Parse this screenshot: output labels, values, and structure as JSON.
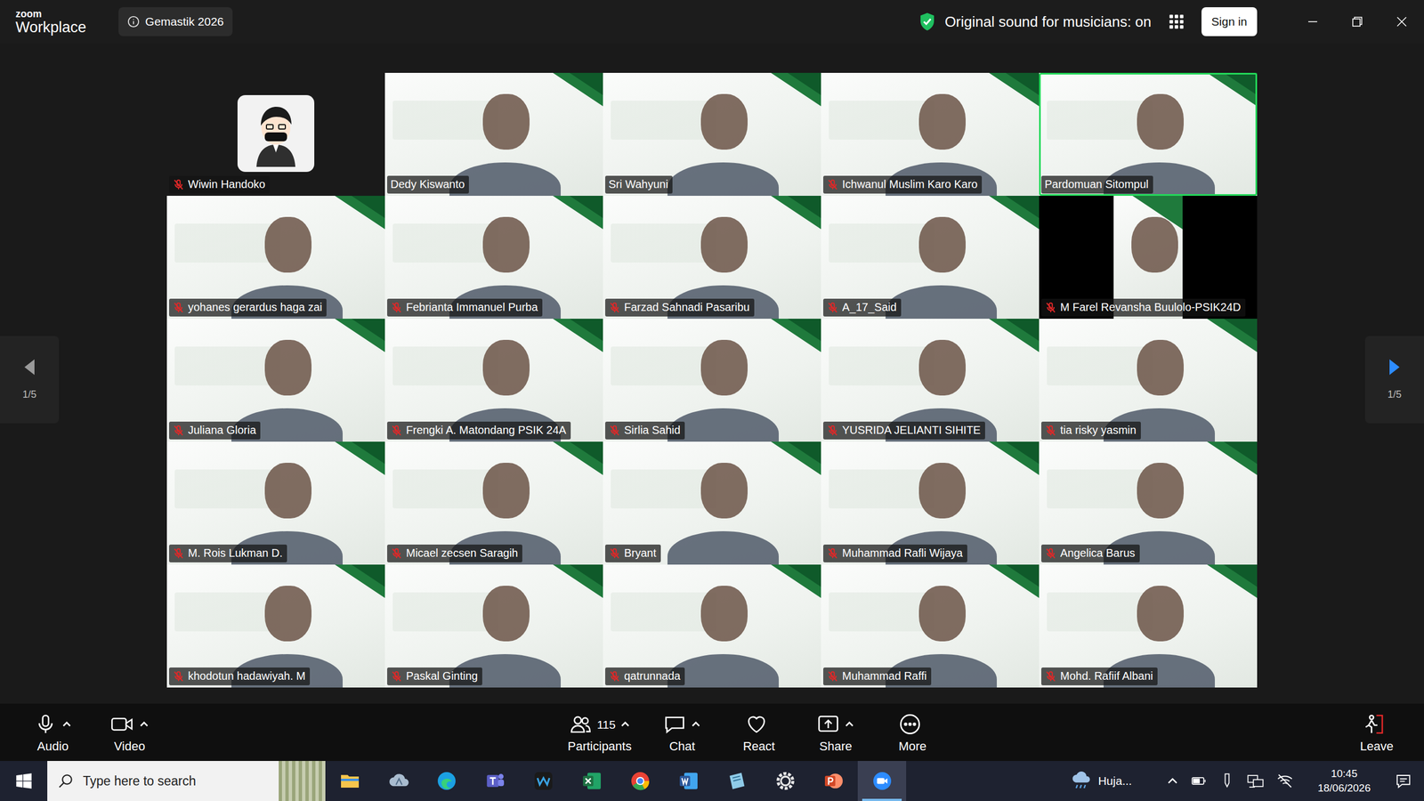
{
  "window": {
    "logo_top": "zoom",
    "logo_bottom": "Workplace",
    "meeting": "Gemastik 2026",
    "sound_status": "Original sound for musicians: on",
    "sign_in": "Sign in"
  },
  "pager": {
    "prev": {
      "label": "1/5",
      "enabled": false
    },
    "next": {
      "label": "1/5",
      "enabled": true
    }
  },
  "tiles": [
    {
      "name": "Wiwin Handoko",
      "muted": true,
      "kind": "avatar",
      "speaking": false
    },
    {
      "name": "Dedy Kiswanto",
      "muted": false,
      "kind": "video",
      "speaking": false
    },
    {
      "name": "Sri Wahyuni",
      "muted": false,
      "kind": "video",
      "speaking": false
    },
    {
      "name": "Ichwanul Muslim Karo Karo",
      "muted": true,
      "kind": "video",
      "speaking": false
    },
    {
      "name": "Pardomuan Sitompul",
      "muted": false,
      "kind": "video",
      "speaking": true
    },
    {
      "name": "yohanes gerardus haga zai",
      "muted": true,
      "kind": "video",
      "speaking": false
    },
    {
      "name": "Febrianta Immanuel Purba",
      "muted": true,
      "kind": "video",
      "speaking": false
    },
    {
      "name": "Farzad Sahnadi Pasaribu",
      "muted": true,
      "kind": "video",
      "speaking": false
    },
    {
      "name": "A_17_Said",
      "muted": true,
      "kind": "video",
      "speaking": false
    },
    {
      "name": "M Farel Revansha Buulolo-PSIK24D",
      "muted": true,
      "kind": "portrait",
      "speaking": false
    },
    {
      "name": "Juliana Gloria",
      "muted": true,
      "kind": "video",
      "speaking": false
    },
    {
      "name": "Frengki A. Matondang PSIK 24A",
      "muted": true,
      "kind": "video",
      "speaking": false
    },
    {
      "name": "Sirlia Sahid",
      "muted": true,
      "kind": "video",
      "speaking": false
    },
    {
      "name": "YUSRIDA JELIANTI SIHITE",
      "muted": true,
      "kind": "video",
      "speaking": false
    },
    {
      "name": "tia risky yasmin",
      "muted": true,
      "kind": "video",
      "speaking": false
    },
    {
      "name": "M. Rois Lukman D.",
      "muted": true,
      "kind": "video",
      "speaking": false
    },
    {
      "name": "Micael zecsen Saragih",
      "muted": true,
      "kind": "video",
      "speaking": false
    },
    {
      "name": "Bryant",
      "muted": true,
      "kind": "video",
      "speaking": false
    },
    {
      "name": "Muhammad Rafli Wijaya",
      "muted": true,
      "kind": "video",
      "speaking": false
    },
    {
      "name": "Angelica Barus",
      "muted": true,
      "kind": "video",
      "speaking": false
    },
    {
      "name": "khodotun hadawiyah. M",
      "muted": true,
      "kind": "video",
      "speaking": false
    },
    {
      "name": "Paskal Ginting",
      "muted": true,
      "kind": "video",
      "speaking": false
    },
    {
      "name": "qatrunnada",
      "muted": true,
      "kind": "video",
      "speaking": false
    },
    {
      "name": "Muhammad Raffi",
      "muted": true,
      "kind": "video",
      "speaking": false
    },
    {
      "name": "Mohd. Rafiif Albani",
      "muted": true,
      "kind": "video",
      "speaking": false
    }
  ],
  "toolbar": {
    "left": [
      {
        "label": "Audio",
        "kind": "audio",
        "menu": true
      },
      {
        "label": "Video",
        "kind": "video",
        "menu": true
      }
    ],
    "center": [
      {
        "label": "Participants",
        "kind": "participants",
        "count": "115",
        "menu": true
      },
      {
        "label": "Chat",
        "kind": "chat",
        "menu": true
      },
      {
        "label": "React",
        "kind": "react",
        "menu": false
      },
      {
        "label": "Share",
        "kind": "share",
        "menu": true
      },
      {
        "label": "More",
        "kind": "more",
        "menu": false
      }
    ],
    "right": [
      {
        "label": "Leave",
        "kind": "leave",
        "menu": false
      }
    ]
  },
  "taskbar": {
    "search_placeholder": "Type here to search",
    "apps": [
      {
        "kind": "explorer",
        "color": "#f6c54c",
        "selected": false
      },
      {
        "kind": "cloud",
        "color": "#a9bccf",
        "selected": false
      },
      {
        "kind": "edge",
        "color": "#1ba0e2",
        "selected": false
      },
      {
        "kind": "teams",
        "color": "#5b5fc7",
        "selected": false
      },
      {
        "kind": "webex",
        "color": "#3aa3e3",
        "selected": false
      },
      {
        "kind": "excel",
        "color": "#1d6f42",
        "selected": false
      },
      {
        "kind": "chrome",
        "color": "#e94235",
        "selected": false
      },
      {
        "kind": "word",
        "color": "#2b579a",
        "selected": false
      },
      {
        "kind": "notes",
        "color": "#8fcbe8",
        "selected": false
      },
      {
        "kind": "settings",
        "color": "#e6e6e6",
        "selected": false
      },
      {
        "kind": "powerpoint",
        "color": "#d24726",
        "selected": false
      },
      {
        "kind": "zoom",
        "color": "#2d8cff",
        "selected": true
      }
    ],
    "weather": "Huja...",
    "time": "10:45",
    "date": "18/06/2026"
  }
}
